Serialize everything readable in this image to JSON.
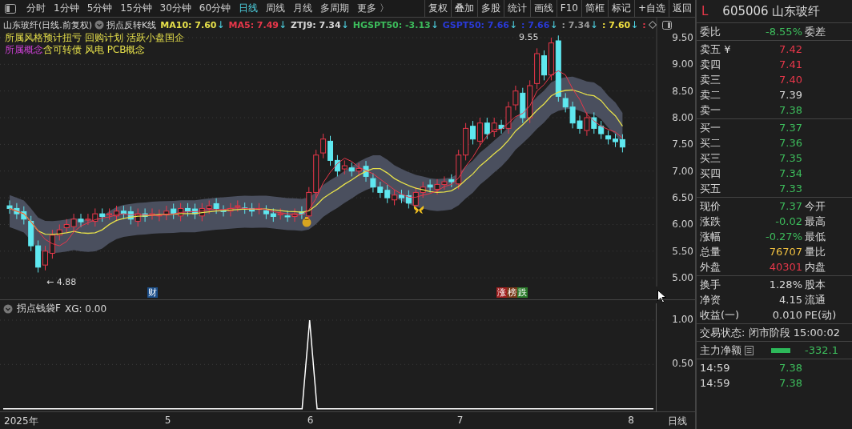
{
  "toolbar": {
    "tabs": [
      {
        "label": "分时",
        "selected": false
      },
      {
        "label": "1分钟",
        "selected": false
      },
      {
        "label": "5分钟",
        "selected": false
      },
      {
        "label": "15分钟",
        "selected": false
      },
      {
        "label": "30分钟",
        "selected": false
      },
      {
        "label": "60分钟",
        "selected": false
      },
      {
        "label": "日线",
        "selected": true
      },
      {
        "label": "周线",
        "selected": false
      },
      {
        "label": "月线",
        "selected": false
      },
      {
        "label": "多周期",
        "selected": false
      },
      {
        "label": "更多 〉",
        "selected": false
      }
    ],
    "buttons": [
      "复权",
      "叠加",
      "多股",
      "统计",
      "画线",
      "F10",
      "简框",
      "标记",
      "+自选",
      "返回"
    ]
  },
  "chart": {
    "title": "山东玻纤(日线.前复权)",
    "indicator": "拐点反转K线",
    "values": [
      {
        "label": "MA10: 7.60",
        "arrow": "↓",
        "color": "#e6e04a"
      },
      {
        "label": "MA5: 7.49",
        "arrow": "↓",
        "color": "#e8374a"
      },
      {
        "label": "ZTJ9: 7.34",
        "arrow": "↓",
        "color": "#d8d8d8"
      },
      {
        "label": "HGSPT50: -3.13",
        "arrow": "↓",
        "color": "#3dbd5c"
      },
      {
        "label": "GSPT50: 7.66",
        "arrow": "↓",
        "color": "#2a3ad8"
      },
      {
        "label": ": 7.66",
        "arrow": "↓",
        "color": "#2a3ad8"
      },
      {
        "label": ": 7.34",
        "arrow": "↓",
        "color": "#9a9a9a"
      },
      {
        "label": ": 7.60",
        "arrow": "↓",
        "color": "#f0e040"
      },
      {
        "label": ":",
        "color": "#e8374a"
      }
    ],
    "style_tags": {
      "label": "所属风格",
      "text": "预计扭亏 回购计划 活跃小盘国企"
    },
    "concept_tags": {
      "label": "所属概念",
      "text": "含可转债 风电 PCB概念"
    },
    "price_axis": [
      "9.50",
      "9.00",
      "8.50",
      "8.00",
      "7.50",
      "7.00",
      "6.50",
      "6.00",
      "5.50",
      "5.00"
    ],
    "high_label": "9.55",
    "low_label": "← 4.88",
    "markers": [
      [
        {
          "text": "财",
          "color": "#1d4f8a"
        }
      ],
      [
        {
          "text": "涨",
          "color": "#a02020"
        },
        {
          "text": "榜",
          "color": "#7a3a1a"
        },
        {
          "text": "跌",
          "color": "#2a7a2a"
        }
      ]
    ]
  },
  "lower": {
    "title": "拐点钱袋F",
    "reading": ": 0.00",
    "period": "日线",
    "dates": [
      "2025年",
      "5",
      "6",
      "7",
      "8"
    ],
    "chart_data": {
      "type": "line",
      "ylim": [
        -0.03,
        1.19
      ],
      "yticks": [
        {
          "value": 0.5,
          "label": "0.50"
        },
        {
          "value": 1,
          "label": "1.00"
        }
      ],
      "series": [
        {
          "name": "XG",
          "color": "#ffffff",
          "values": [
            0,
            0,
            0,
            0,
            0,
            0,
            0,
            0,
            0,
            0,
            0,
            0,
            0,
            0,
            0,
            0,
            0,
            0,
            0,
            0,
            0,
            0,
            0,
            0,
            0,
            0,
            0,
            0,
            0,
            0,
            0,
            0,
            0,
            0,
            0,
            0,
            0,
            0,
            0,
            0,
            0,
            1,
            0,
            0,
            0,
            0,
            0,
            0,
            0,
            0,
            0,
            0,
            0,
            0,
            0,
            0,
            0,
            0,
            0,
            0,
            0,
            0,
            0,
            0,
            0,
            0,
            0,
            0,
            0,
            0,
            0,
            0,
            0,
            0,
            0,
            0,
            0,
            0,
            0,
            0,
            0,
            0,
            0,
            0,
            0,
            0,
            0,
            0
          ]
        }
      ]
    }
  },
  "quote": {
    "flag": "L",
    "title": "605006 山东玻纤",
    "ratio": {
      "label": "委比",
      "value": "-8.55%",
      "color": "#3dbd5c",
      "label2": "委差"
    },
    "sells": [
      {
        "label": "卖五 ¥",
        "value": "7.42",
        "color": "#e8374a"
      },
      {
        "label": "卖四",
        "value": "7.41",
        "color": "#e8374a"
      },
      {
        "label": "卖三",
        "value": "7.40",
        "color": "#e8374a"
      },
      {
        "label": "卖二",
        "value": "7.39",
        "color": "#d8d8d8"
      },
      {
        "label": "卖一",
        "value": "7.38",
        "color": "#3dbd5c"
      }
    ],
    "buys": [
      {
        "label": "买一",
        "value": "7.37",
        "color": "#3dbd5c"
      },
      {
        "label": "买二",
        "value": "7.36",
        "color": "#3dbd5c"
      },
      {
        "label": "买三",
        "value": "7.35",
        "color": "#3dbd5c"
      },
      {
        "label": "买四",
        "value": "7.34",
        "color": "#3dbd5c"
      },
      {
        "label": "买五",
        "value": "7.33",
        "color": "#3dbd5c"
      }
    ],
    "stats": [
      {
        "label": "现价",
        "value": "7.37",
        "color": "#3dbd5c",
        "label2": "今开"
      },
      {
        "label": "涨跌",
        "value": "-0.02",
        "color": "#3dbd5c",
        "label2": "最高"
      },
      {
        "label": "涨幅",
        "value": "-0.27%",
        "color": "#3dbd5c",
        "label2": "最低"
      },
      {
        "label": "总量",
        "value": "76707",
        "color": "#f0c040",
        "label2": "量比"
      },
      {
        "label": "外盘",
        "value": "40301",
        "color": "#e8374a",
        "label2": "内盘"
      }
    ],
    "stats2": [
      {
        "label": "换手",
        "value": "1.28%",
        "color": "#d8d8d8",
        "label2": "股本"
      },
      {
        "label": "净资",
        "value": "4.15",
        "color": "#d8d8d8",
        "label2": "流通"
      },
      {
        "label": "收益(一)",
        "value": "0.010",
        "color": "#d8d8d8",
        "label2": "PE(动)"
      }
    ],
    "status": "交易状态: 闭市阶段 15:00:02",
    "main_flow": {
      "label": "主力净额",
      "value": "-332.1"
    },
    "ticks": [
      {
        "time": "14:59",
        "price": "7.38",
        "color": "#3dbd5c"
      },
      {
        "time": "14:59",
        "price": "7.38",
        "color": "#3dbd5c"
      }
    ]
  }
}
